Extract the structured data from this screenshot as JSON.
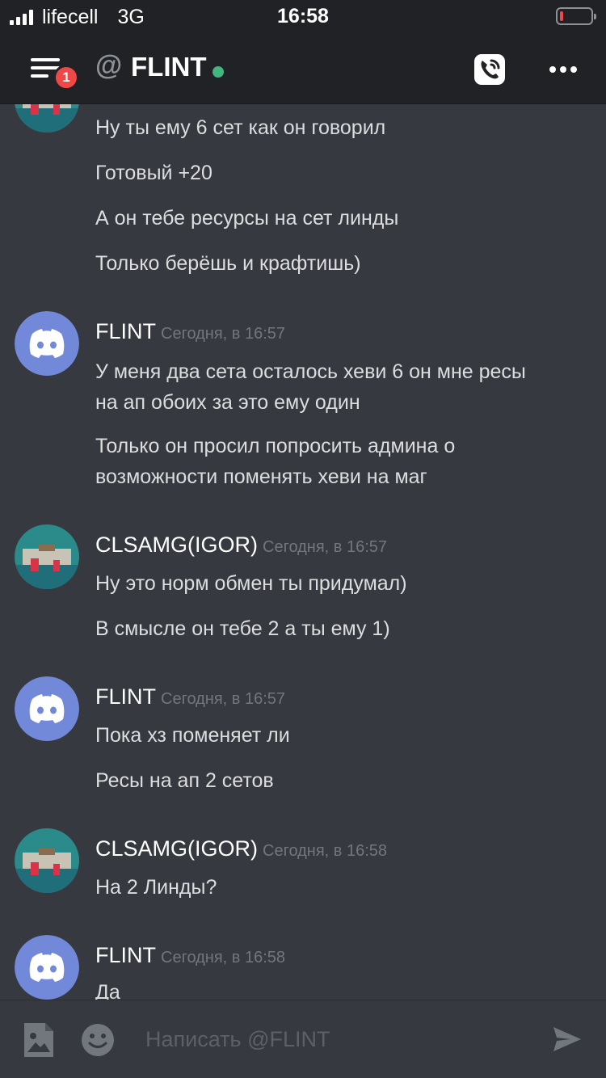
{
  "status_bar": {
    "carrier": "lifecell",
    "network": "3G",
    "time": "16:58",
    "battery_level": 0.1
  },
  "header": {
    "menu_badge": "1",
    "at": "@",
    "channel_name": "FLINT",
    "online_color": "#43b581",
    "call_icon": "phone-call-icon",
    "more_icon": "more-dots-icon"
  },
  "messages": {
    "g0": {
      "avatar": "photo-avatar",
      "lines": [
        "Ну ты ему 6 сет как он говорил",
        "Готовый +20",
        "А он тебе ресурсы на сет линды",
        "Только берёшь и крафтишь)"
      ]
    },
    "g1": {
      "author": "FLINT",
      "timestamp": "Сегодня, в 16:57",
      "avatar": "discord-logo-avatar",
      "lines": [
        "У меня два сета осталось хеви 6 он мне ресы",
        "на ап обоих за это ему один",
        "Только он просил попросить админа о",
        "возможности поменять хеви на маг"
      ]
    },
    "g2": {
      "author": "CLSAMG(IGOR)",
      "timestamp": "Сегодня, в 16:57",
      "avatar": "photo-avatar",
      "lines": [
        "Ну это норм обмен ты придумал)",
        "В смысле он тебе 2 а ты ему 1)"
      ]
    },
    "g3": {
      "author": "FLINT",
      "timestamp": "Сегодня, в 16:57",
      "avatar": "discord-logo-avatar",
      "lines": [
        "Пока хз поменяет ли",
        "Ресы на ап 2 сетов"
      ]
    },
    "g4": {
      "author": "CLSAMG(IGOR)",
      "timestamp": "Сегодня, в 16:58",
      "avatar": "photo-avatar",
      "lines": [
        "На 2 Линды?"
      ]
    },
    "g5": {
      "author": "FLINT",
      "timestamp": "Сегодня, в 16:58",
      "avatar": "discord-logo-avatar",
      "lines": [
        "Да"
      ]
    }
  },
  "composer": {
    "placeholder": "Написать @FLINT",
    "image_icon": "image-icon",
    "emoji_icon": "emoji-icon",
    "send_icon": "send-icon"
  },
  "colors": {
    "background": "#36393f",
    "header": "#202225",
    "blurple": "#7289da",
    "badge": "#f04747"
  }
}
